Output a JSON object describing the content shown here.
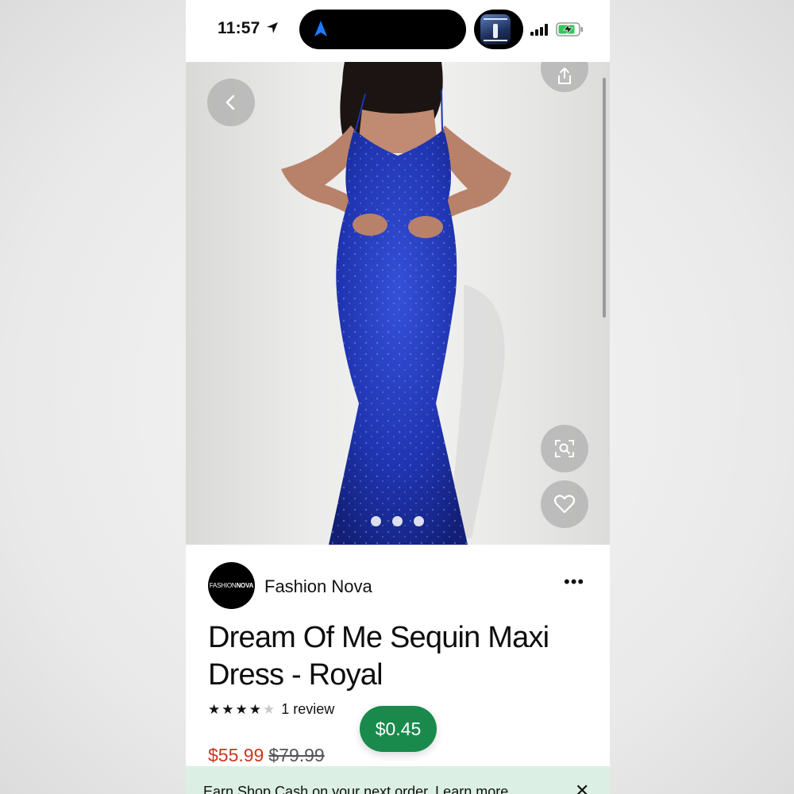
{
  "status_bar": {
    "time": "11:57",
    "icons": [
      "location-arrow-icon",
      "cellular-signal-icon",
      "battery-charging-icon"
    ],
    "island_icon": "navigation-arrow-icon",
    "now_playing_art": "album-art"
  },
  "hero": {
    "buttons": [
      "back-chevron-icon",
      "share-icon",
      "visual-search-icon",
      "heart-icon"
    ],
    "image_count": 3,
    "dress_color": "#1f34b0"
  },
  "shop": {
    "logo_text_light": "FASHION",
    "logo_text_bold": "NOVA",
    "name": "Fashion Nova",
    "more_label": "•••"
  },
  "product": {
    "title": "Dream Of Me Sequin Maxi Dress - Royal",
    "rating_stars": 4,
    "rating_max": 5,
    "review_text": "1 review",
    "price_sale": "$55.99",
    "price_original": "$79.99"
  },
  "cash_badge": {
    "label": "$0.45",
    "color": "#1a8a4c"
  },
  "banner": {
    "text": "Earn Shop Cash on your next order. Learn more",
    "close_label": "✕",
    "background": "#dcefe4"
  }
}
